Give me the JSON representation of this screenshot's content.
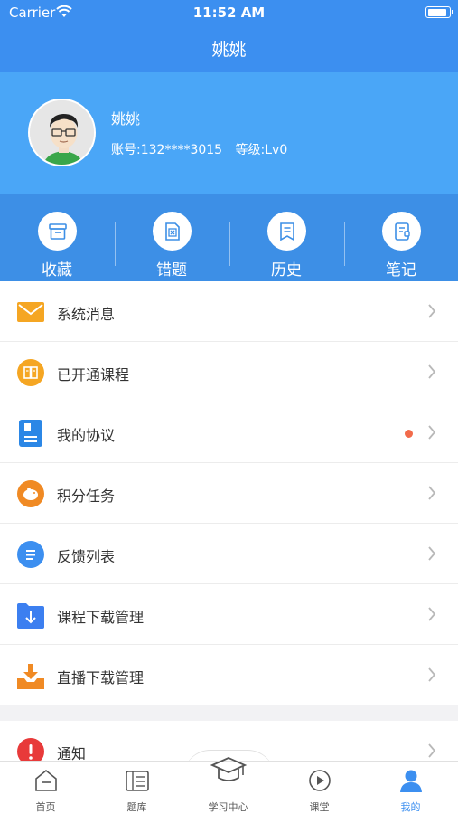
{
  "status": {
    "carrier": "Carrier",
    "time": "11:52 AM"
  },
  "nav": {
    "title": "姚姚"
  },
  "profile": {
    "name": "姚姚",
    "account": "账号:132****3015",
    "level": "等级:Lv0"
  },
  "quick": [
    {
      "label": "收藏",
      "icon": "archive-icon"
    },
    {
      "label": "错题",
      "icon": "wrong-question-icon"
    },
    {
      "label": "历史",
      "icon": "history-icon"
    },
    {
      "label": "笔记",
      "icon": "notebook-icon"
    }
  ],
  "menu": [
    {
      "label": "系统消息",
      "icon": "mail-icon",
      "color": "#f5a623"
    },
    {
      "label": "已开通课程",
      "icon": "book-icon",
      "color": "#f5a623"
    },
    {
      "label": "我的协议",
      "icon": "agreement-icon",
      "color": "#2b87e6",
      "badge": true
    },
    {
      "label": "积分任务",
      "icon": "piggy-bank-icon",
      "color": "#f08a24"
    },
    {
      "label": "反馈列表",
      "icon": "feedback-icon",
      "color": "#3c8ff0"
    },
    {
      "label": "课程下载管理",
      "icon": "download-folder-icon",
      "color": "#3c7ff0"
    },
    {
      "label": "直播下载管理",
      "icon": "download-tray-icon",
      "color": "#f08a24"
    }
  ],
  "menu2": [
    {
      "label": "通知",
      "icon": "alert-icon",
      "color": "#e83a3a"
    }
  ],
  "tabs": [
    {
      "label": "首页",
      "icon": "home-icon"
    },
    {
      "label": "题库",
      "icon": "question-bank-icon"
    },
    {
      "label": "学习中心",
      "icon": "graduation-cap-icon"
    },
    {
      "label": "课堂",
      "icon": "play-icon"
    },
    {
      "label": "我的",
      "icon": "user-icon",
      "active": true
    }
  ],
  "colors": {
    "primary": "#3c8ff0",
    "profile_bg": "#4aa6f7",
    "quick_bg": "#3d8fe6",
    "badge": "#f26b4b"
  }
}
